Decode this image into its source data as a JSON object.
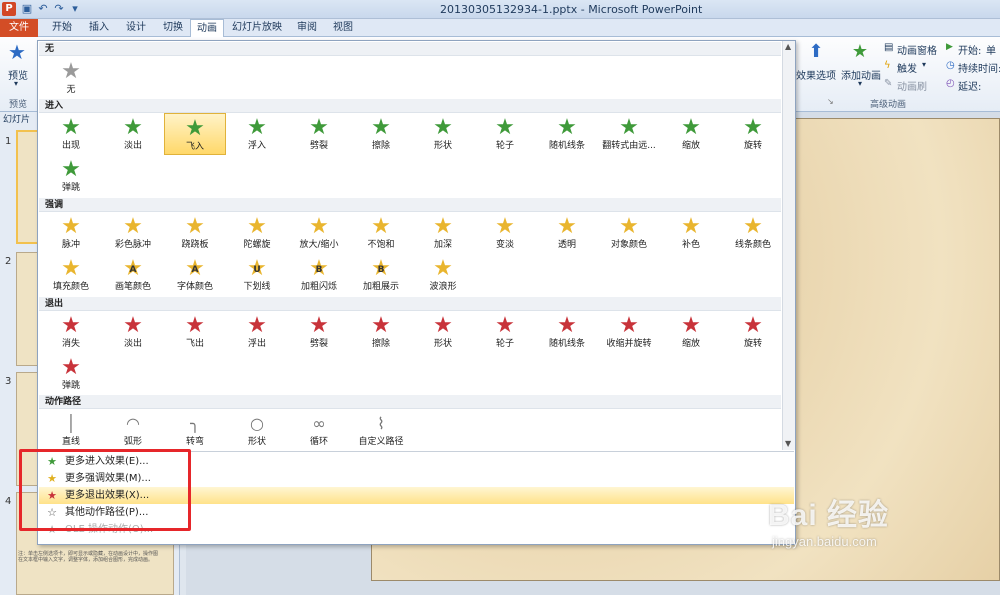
{
  "window": {
    "title": "20130305132934-1.pptx - Microsoft PowerPoint"
  },
  "tabs": [
    "文件",
    "开始",
    "插入",
    "设计",
    "切换",
    "动画",
    "幻灯片放映",
    "审阅",
    "视图"
  ],
  "ribbon": {
    "preview_label": "预览",
    "preview_group": "预览",
    "effect_options": "效果选项",
    "add_animation": "添加动画",
    "anim_pane": "动画窗格",
    "trigger": "触发",
    "anim_painter": "动画刷",
    "advanced_group": "高级动画",
    "start_label": "开始:",
    "start_value": "单",
    "duration_label": "持续时间:",
    "delay_label": "延迟:"
  },
  "slides_panel": {
    "tab_label": "幻灯片",
    "numbers": [
      "1",
      "2",
      "3",
      "4"
    ],
    "thumb4_text": "注：单击左侧选项卡，即可显示或隐藏，在动画设计中，操作图",
    "thumb4_text2": "在文本框中输入文字，调整字体，添加组合图形，完成动画。"
  },
  "gallery": {
    "sections": {
      "none": "无",
      "entry": "进入",
      "emphasis": "强调",
      "exit": "退出",
      "paths": "动作路径"
    },
    "none_items": [
      "无"
    ],
    "entry_items": [
      "出现",
      "淡出",
      "飞入",
      "浮入",
      "劈裂",
      "擦除",
      "形状",
      "轮子",
      "随机线条",
      "翻转式由远...",
      "缩放",
      "旋转",
      "弹跳"
    ],
    "emphasis_items": [
      "脉冲",
      "彩色脉冲",
      "跷跷板",
      "陀螺旋",
      "放大/缩小",
      "不饱和",
      "加深",
      "变淡",
      "透明",
      "对象颜色",
      "补色",
      "线条颜色",
      "填充颜色",
      "画笔颜色",
      "字体颜色",
      "下划线",
      "加粗闪烁",
      "加粗展示",
      "波浪形"
    ],
    "emphasis_glyphs": [
      "",
      "",
      "",
      "",
      "",
      "",
      "",
      "",
      "",
      "",
      "",
      "",
      "",
      "A",
      "A",
      "U",
      "B",
      "B",
      ""
    ],
    "exit_items": [
      "消失",
      "淡出",
      "飞出",
      "浮出",
      "劈裂",
      "擦除",
      "形状",
      "轮子",
      "随机线条",
      "收缩并旋转",
      "缩放",
      "旋转",
      "弹跳"
    ],
    "path_items": [
      "直线",
      "弧形",
      "转弯",
      "形状",
      "循环",
      "自定义路径"
    ],
    "path_glyphs": [
      "│",
      "◠",
      "╮",
      "○",
      "∞",
      "⌇"
    ],
    "selected_entry": "飞入"
  },
  "more_menu": [
    {
      "label": "更多进入效果(E)...",
      "icon": "green-star-icon",
      "color": "#3f9a3a"
    },
    {
      "label": "更多强调效果(M)...",
      "icon": "yellow-star-icon",
      "color": "#e0b020"
    },
    {
      "label": "更多退出效果(X)...",
      "icon": "red-star-icon",
      "color": "#c8333a"
    },
    {
      "label": "其他动作路径(P)...",
      "icon": "outline-star-icon",
      "color": "#555555"
    },
    {
      "label": "OLE 操作动作(O)...",
      "icon": "ole-icon",
      "color": "#aaaaaa"
    }
  ],
  "watermark": {
    "brand": "Bai 经验",
    "url": "jingyan.baidu.com"
  },
  "colors": {
    "file_tab": "#d34d26",
    "highlight": "#ffd86a",
    "redbox": "#e6262a"
  }
}
